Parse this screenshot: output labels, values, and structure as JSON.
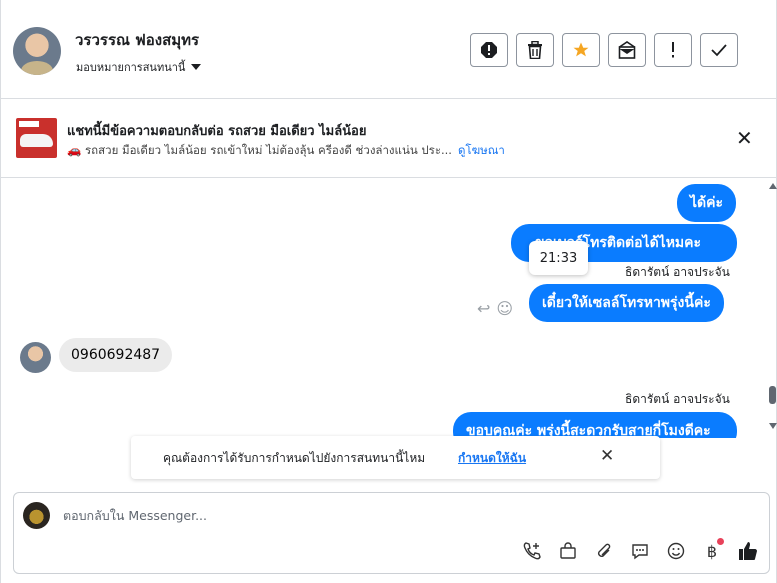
{
  "header": {
    "name": "วรวรรณ ฟองสมุทร",
    "assign_label": "มอบหมายการสนทนานี้"
  },
  "ad": {
    "title": "แชทนี้มีข้อความตอบกลับต่อ รถสวย มือเดียว ไมล์น้อย",
    "subtitle": "🚗 รถสวย มือเดียว ไมล์น้อย รถเข้าใหม่ ไม่ต้องลุ้น ครีองดี ช่วงล่างแน่น ประ...",
    "link": "ดูโฆษณา"
  },
  "messages": {
    "m1": "ได้ค่ะ",
    "m2": "ขอเบอร์โทรติดต่อได้ไหมคะ",
    "sender1": "ธิดารัตน์ อาจประจัน",
    "tooltip": "21:33",
    "m3": "เดี๋ยวให้เซลล์โทรหาพรุ่งนี้ค่ะ",
    "incoming": "0960692487",
    "sender2": "ธิดารัตน์ อาจประจัน",
    "m4": "ขอบคุณค่ะ พรุ่งนี้สะดวกรับสายกี่โมงดีคะ"
  },
  "notice": {
    "text": "คุณต้องการได้รับการกำหนดไปยังการสนทนานี้ไหม",
    "link": "กำหนดให้ฉัน"
  },
  "composer": {
    "placeholder": "ตอบกลับใน Messenger..."
  }
}
